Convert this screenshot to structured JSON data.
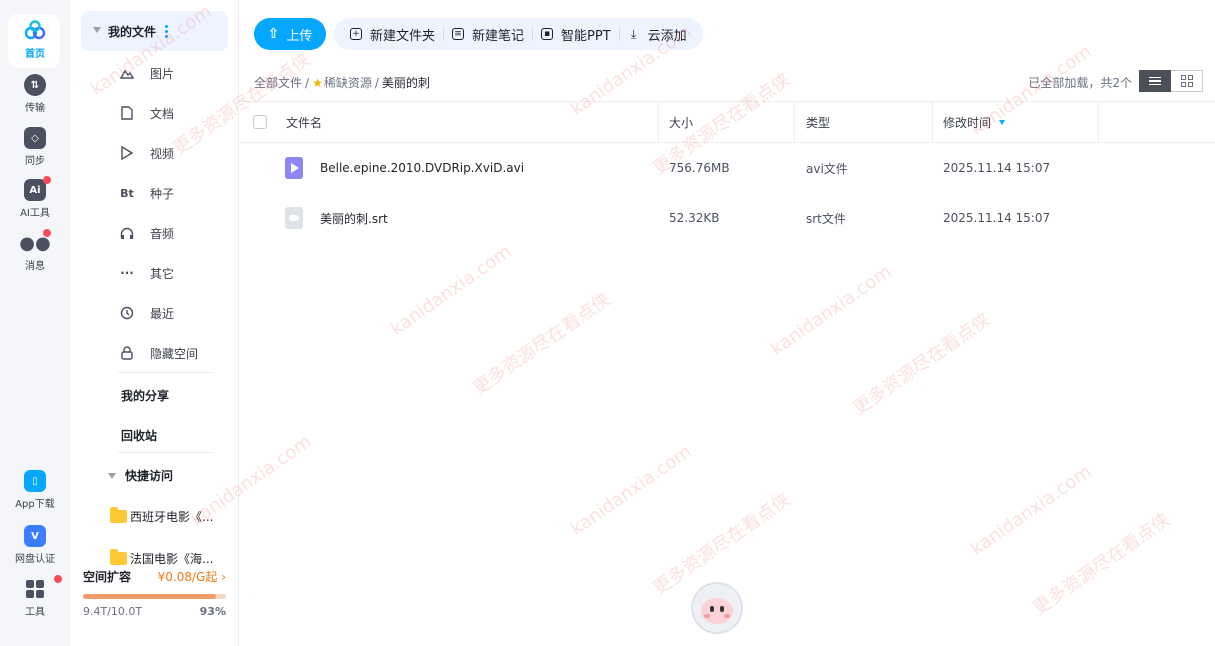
{
  "rail": [
    {
      "label": "首页",
      "icon": "home-icon",
      "active": true
    },
    {
      "label": "传输",
      "icon": "transfer-icon"
    },
    {
      "label": "同步",
      "icon": "sync-icon"
    },
    {
      "label": "AI工具",
      "icon": "ai-tool-icon",
      "badge": true
    },
    {
      "label": "消息",
      "icon": "message-icon",
      "badge": true
    },
    {
      "label": "App下载",
      "icon": "phone-icon"
    },
    {
      "label": "网盘认证",
      "icon": "verify-icon"
    },
    {
      "label": "工具",
      "icon": "tools-icon",
      "badge": true
    }
  ],
  "nav": {
    "my_files": "我的文件",
    "items": [
      {
        "label": "图片",
        "icon": "image-icon"
      },
      {
        "label": "文档",
        "icon": "document-icon"
      },
      {
        "label": "视频",
        "icon": "video-icon"
      },
      {
        "label": "种子",
        "icon": "torrent-icon"
      },
      {
        "label": "音频",
        "icon": "audio-icon"
      },
      {
        "label": "其它",
        "icon": "more-icon"
      },
      {
        "label": "最近",
        "icon": "recent-icon"
      },
      {
        "label": "隐藏空间",
        "icon": "lock-icon"
      }
    ],
    "my_share": "我的分享",
    "recycle": "回收站",
    "quick_access": "快捷访问",
    "quick_folders": [
      "西班牙电影《...",
      "法国电影《海..."
    ],
    "quota": {
      "title": "空间扩容",
      "price": "¥0.08/G起",
      "used": "9.4T/10.0T",
      "percent_text": "93%",
      "percent": 93
    }
  },
  "toolbar": {
    "upload": "上传",
    "tools": [
      {
        "label": "新建文件夹",
        "icon": "new-folder-icon"
      },
      {
        "label": "新建笔记",
        "icon": "new-note-icon"
      },
      {
        "label": "智能PPT",
        "icon": "ppt-icon"
      },
      {
        "label": "云添加",
        "icon": "cloud-add-icon"
      }
    ]
  },
  "breadcrumb": {
    "root": "全部文件",
    "parent": "稀缺资源",
    "current": "美丽的刺"
  },
  "load_info": "已全部加载，共2个",
  "table": {
    "headers": {
      "name": "文件名",
      "size": "大小",
      "type": "类型",
      "modified": "修改时间"
    },
    "rows": [
      {
        "name": "Belle.epine.2010.DVDRip.XviD.avi",
        "size": "756.76MB",
        "type": "avi文件",
        "modified": "2025.11.14 15:07",
        "kind": "video"
      },
      {
        "name": "美丽的刺.srt",
        "size": "52.32KB",
        "type": "srt文件",
        "modified": "2025.11.14 15:07",
        "kind": "srt"
      }
    ]
  },
  "watermark": {
    "line1": "kanidanxia.com",
    "line2": "更多资源尽在看点侠"
  },
  "colors": {
    "accent": "#06a7ff",
    "quota": "#f29d67",
    "badge": "#fa4b5b"
  }
}
